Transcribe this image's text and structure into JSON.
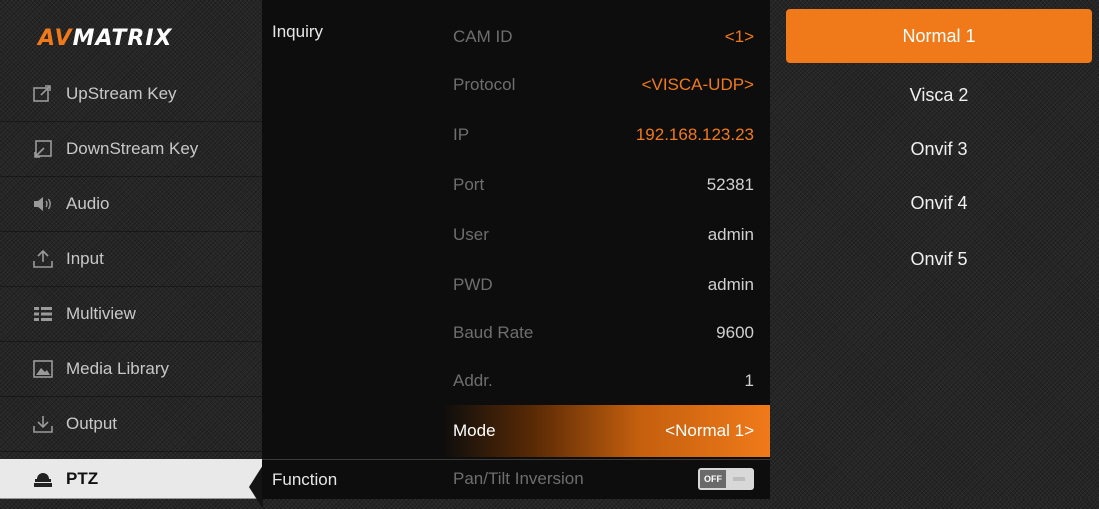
{
  "brand": {
    "logo_left": "AV",
    "logo_right": "MATRIX"
  },
  "sidebar": {
    "items": [
      {
        "label": "UpStream Key",
        "icon": "upstream-key-icon"
      },
      {
        "label": "DownStream Key",
        "icon": "downstream-key-icon"
      },
      {
        "label": "Audio",
        "icon": "speaker-icon"
      },
      {
        "label": "Input",
        "icon": "input-icon"
      },
      {
        "label": "Multiview",
        "icon": "multiview-icon"
      },
      {
        "label": "Media Library",
        "icon": "image-icon"
      },
      {
        "label": "Output",
        "icon": "output-icon"
      },
      {
        "label": "PTZ",
        "icon": "camera-icon",
        "active": true
      }
    ]
  },
  "panel": {
    "sections": {
      "inquiry": "Inquiry",
      "function": "Function"
    },
    "rows": [
      {
        "key": "CAM ID",
        "value": "<1>"
      },
      {
        "key": "Protocol",
        "value": "<VISCA-UDP>"
      },
      {
        "key": "IP",
        "value": "192.168.123.23"
      },
      {
        "key": "Port",
        "value": "52381"
      },
      {
        "key": "User",
        "value": "admin"
      },
      {
        "key": "PWD",
        "value": "admin"
      },
      {
        "key": "Baud Rate",
        "value": "9600"
      },
      {
        "key": "Addr.",
        "value": "1"
      },
      {
        "key": "Mode",
        "value": "<Normal 1>"
      }
    ],
    "function_row": {
      "key": "Pan/Tilt Inversion",
      "toggle_label": "OFF",
      "toggle_state": "off"
    }
  },
  "presets": {
    "items": [
      "Normal 1",
      "Visca 2",
      "Onvif 3",
      "Onvif 4",
      "Onvif 5"
    ],
    "selected_index": 0
  },
  "colors": {
    "accent": "#f07a1a",
    "background": "#262626",
    "panel": "#0d0d0d"
  }
}
